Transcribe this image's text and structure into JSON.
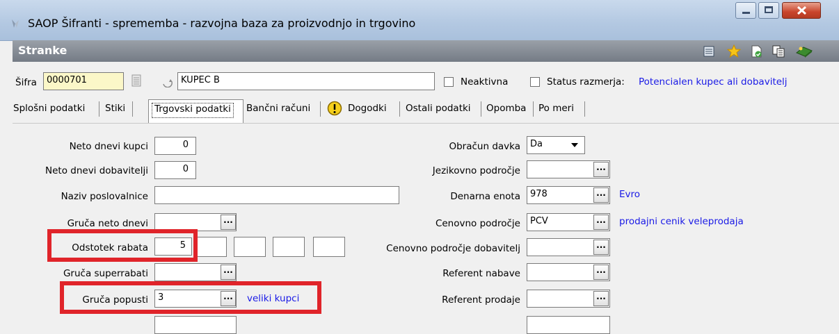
{
  "window": {
    "title": "SAOP Šifranti - sprememba - razvojna baza za proizvodnjo in trgovino"
  },
  "section": {
    "title": "Stranke"
  },
  "header_fields": {
    "sifra_label": "Šifra",
    "sifra_value": "0000701",
    "name_value": "KUPEC B",
    "neaktivna_label": "Neaktivna",
    "status_label": "Status razmerja:",
    "status_value": "Potencialen kupec ali dobavitelj"
  },
  "tabs": [
    {
      "label": "Splošni podatki"
    },
    {
      "label": "Stiki"
    },
    {
      "label": "Trgovski podatki"
    },
    {
      "label": "Bančni računi"
    },
    {
      "label": "Dogodki"
    },
    {
      "label": "Ostali podatki"
    },
    {
      "label": "Opomba"
    },
    {
      "label": "Po meri"
    }
  ],
  "left_fields": {
    "neto_dnevi_kupci_label": "Neto dnevi kupci",
    "neto_dnevi_kupci_value": "0",
    "neto_dnevi_dobavitelji_label": "Neto dnevi dobavitelji",
    "neto_dnevi_dobavitelji_value": "0",
    "naziv_poslovalnice_label": "Naziv poslovalnice",
    "naziv_poslovalnice_value": "",
    "gruca_neto_dnevi_label": "Gruča neto dnevi",
    "odstotek_rabata_label": "Odstotek rabata",
    "odstotek_rabata_value": "5",
    "gruca_superrabati_label": "Gruča superrabati",
    "gruca_popusti_label": "Gruča popusti",
    "gruca_popusti_value": "3",
    "gruca_popusti_desc": "veliki kupci"
  },
  "right_fields": {
    "obracun_davka_label": "Obračun davka",
    "obracun_davka_value": "Da",
    "jezikovno_podrocje_label": "Jezikovno področje",
    "denarna_enota_label": "Denarna enota",
    "denarna_enota_value": "978",
    "denarna_enota_desc": "Evro",
    "cenovno_podrocje_label": "Cenovno področje",
    "cenovno_podrocje_value": "PCV",
    "cenovno_podrocje_desc": "prodajni cenik veleprodaja",
    "cenovno_podrocje_dob_label": "Cenovno področje dobavitelj",
    "referent_nabave_label": "Referent nabave",
    "referent_prodaje_label": "Referent prodaje"
  },
  "buttons": {
    "dots": "..."
  },
  "colors": {
    "highlight_red": "#e0242a",
    "link_blue": "#1a1ae6",
    "sifra_bg": "#fbf7c8"
  }
}
